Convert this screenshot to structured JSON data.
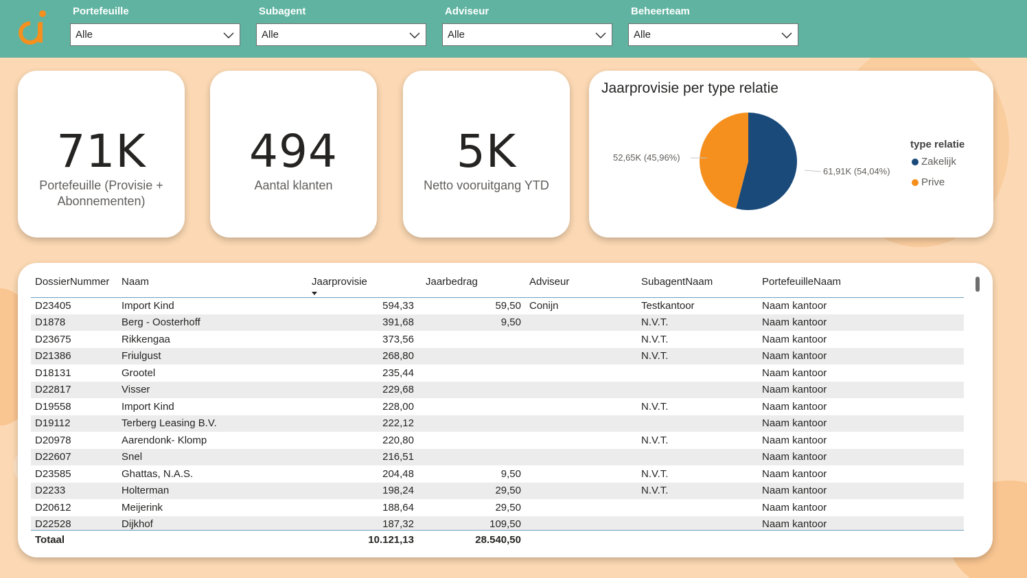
{
  "filters": [
    {
      "label": "Portefeuille",
      "value": "Alle"
    },
    {
      "label": "Subagent",
      "value": "Alle"
    },
    {
      "label": "Adviseur",
      "value": "Alle"
    },
    {
      "label": "Beheerteam",
      "value": "Alle"
    }
  ],
  "kpis": [
    {
      "value": "71K",
      "label": "Portefeuille (Provisie + Abonnementen)"
    },
    {
      "value": "494",
      "label": "Aantal klanten"
    },
    {
      "value": "5K",
      "label": "Netto vooruitgang YTD"
    }
  ],
  "pie": {
    "title": "Jaarprovisie per type relatie",
    "legend_title": "type relatie",
    "slices": [
      {
        "name": "Zakelijk",
        "label": "61,91K (54,04%)",
        "value": 61.91,
        "percent": 54.04,
        "color": "#1a4a7a"
      },
      {
        "name": "Prive",
        "label": "52,65K (45,96%)",
        "value": 52.65,
        "percent": 45.96,
        "color": "#f5901e"
      }
    ]
  },
  "table": {
    "columns": [
      "DossierNummer",
      "Naam",
      "Jaarprovisie",
      "Jaarbedrag",
      "Adviseur",
      "SubagentNaam",
      "PortefeuilleNaam"
    ],
    "rows": [
      [
        "D23405",
        "Import Kind",
        "594,33",
        "59,50",
        "Conijn",
        "Testkantoor",
        "Naam kantoor"
      ],
      [
        "D1878",
        "Berg - Oosterhoff",
        "391,68",
        "9,50",
        "",
        "N.V.T.",
        "Naam kantoor"
      ],
      [
        "D23675",
        "Rikkengaa",
        "373,56",
        "",
        "",
        "N.V.T.",
        "Naam kantoor"
      ],
      [
        "D21386",
        "Friulgust",
        "268,80",
        "",
        "",
        "N.V.T.",
        "Naam kantoor"
      ],
      [
        "D18131",
        "Grootel",
        "235,44",
        "",
        "",
        "",
        "Naam kantoor"
      ],
      [
        "D22817",
        "Visser",
        "229,68",
        "",
        "",
        "",
        "Naam kantoor"
      ],
      [
        "D19558",
        "Import Kind",
        "228,00",
        "",
        "",
        "N.V.T.",
        "Naam kantoor"
      ],
      [
        "D19112",
        "Terberg Leasing B.V.",
        "222,12",
        "",
        "",
        "",
        "Naam kantoor"
      ],
      [
        "D20978",
        "Aarendonk- Klomp",
        "220,80",
        "",
        "",
        "N.V.T.",
        "Naam kantoor"
      ],
      [
        "D22607",
        "Snel",
        "216,51",
        "",
        "",
        "",
        "Naam kantoor"
      ],
      [
        "D23585",
        "Ghattas, N.A.S.",
        "204,48",
        "9,50",
        "",
        "N.V.T.",
        "Naam kantoor"
      ],
      [
        "D2233",
        "Holterman",
        "198,24",
        "29,50",
        "",
        "N.V.T.",
        "Naam kantoor"
      ],
      [
        "D20612",
        "Meijerink",
        "188,64",
        "29,50",
        "",
        "",
        "Naam kantoor"
      ],
      [
        "D22528",
        "Dijkhof",
        "187,32",
        "109,50",
        "",
        "",
        "Naam kantoor"
      ]
    ],
    "total": {
      "label": "Totaal",
      "jaarprovisie": "10.121,13",
      "jaarbedrag": "28.540,50"
    }
  },
  "colors": {
    "topbar": "#5fb3a0",
    "background": "#fcd9b4",
    "zakelijk": "#1a4a7a",
    "prive": "#f5901e",
    "logo": "#f5901e"
  }
}
